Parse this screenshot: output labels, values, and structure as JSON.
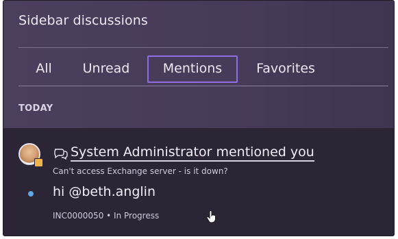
{
  "sidebar": {
    "title": "Sidebar discussions",
    "tabs": [
      {
        "label": "All"
      },
      {
        "label": "Unread"
      },
      {
        "label": "Mentions",
        "selected": true
      },
      {
        "label": "Favorites"
      }
    ],
    "section_label": "TODAY",
    "items": [
      {
        "icon": "mention-icon",
        "title": "System Administrator mentioned you",
        "subtitle": "Can't access Exchange server - is it down?",
        "message": "hi @beth.anglin",
        "meta": "INC0000050 • In Progress",
        "unread": true
      }
    ]
  },
  "colors": {
    "panel_bg": "#2c2536",
    "header_bg": "#4a3f5c",
    "tab_focus": "#8f6fe3",
    "unread_dot": "#5fa8e6",
    "text": "#ece8f2"
  }
}
